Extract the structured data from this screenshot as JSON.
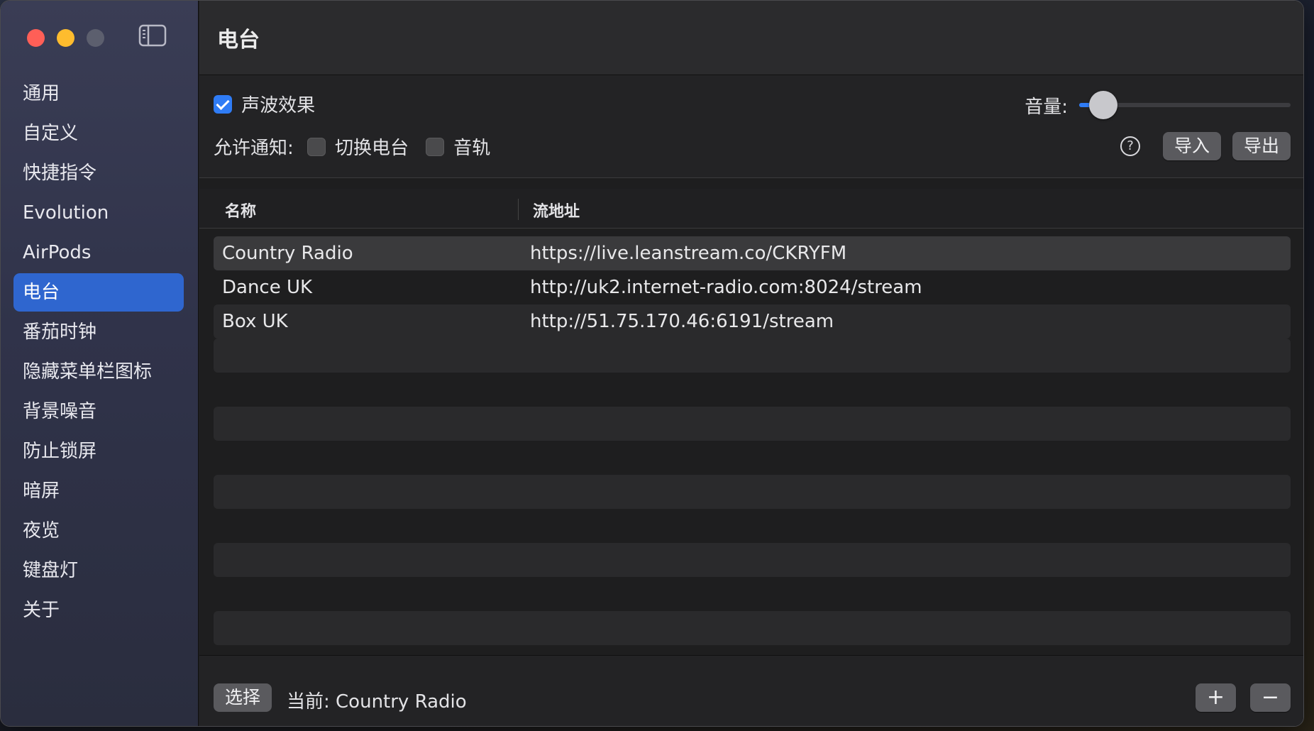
{
  "sidebar": {
    "items": [
      {
        "label": "通用"
      },
      {
        "label": "自定义"
      },
      {
        "label": "快捷指令"
      },
      {
        "label": "Evolution"
      },
      {
        "label": "AirPods"
      },
      {
        "label": "电台",
        "active": true
      },
      {
        "label": "番茄时钟"
      },
      {
        "label": "隐藏菜单栏图标"
      },
      {
        "label": "背景噪音"
      },
      {
        "label": "防止锁屏"
      },
      {
        "label": "暗屏"
      },
      {
        "label": "夜览"
      },
      {
        "label": "键盘灯"
      },
      {
        "label": "关于"
      }
    ]
  },
  "header": {
    "title": "电台"
  },
  "settings": {
    "wave_effect_label": "声波效果",
    "wave_effect_checked": true,
    "volume_label": "音量:",
    "volume_level": 0.1,
    "notify_label": "允许通知:",
    "switch_station_label": "切换电台",
    "switch_station_checked": false,
    "track_label": "音轨",
    "track_checked": false,
    "help_symbol": "?",
    "import_label": "导入",
    "export_label": "导出"
  },
  "table": {
    "columns": [
      "名称",
      "流地址"
    ],
    "rows": [
      {
        "name": "Country Radio",
        "url": "https://live.leanstream.co/CKRYFM"
      },
      {
        "name": "Dance UK",
        "url": "http://uk2.internet-radio.com:8024/stream"
      },
      {
        "name": "Box UK",
        "url": "http://51.75.170.46:6191/stream"
      }
    ]
  },
  "footer": {
    "choose_label": "选择",
    "current_text": "当前: Country Radio",
    "add_symbol": "+",
    "remove_symbol": "−"
  },
  "colors": {
    "accent": "#2f7cf6",
    "sidebar_active": "#2f66cf"
  }
}
